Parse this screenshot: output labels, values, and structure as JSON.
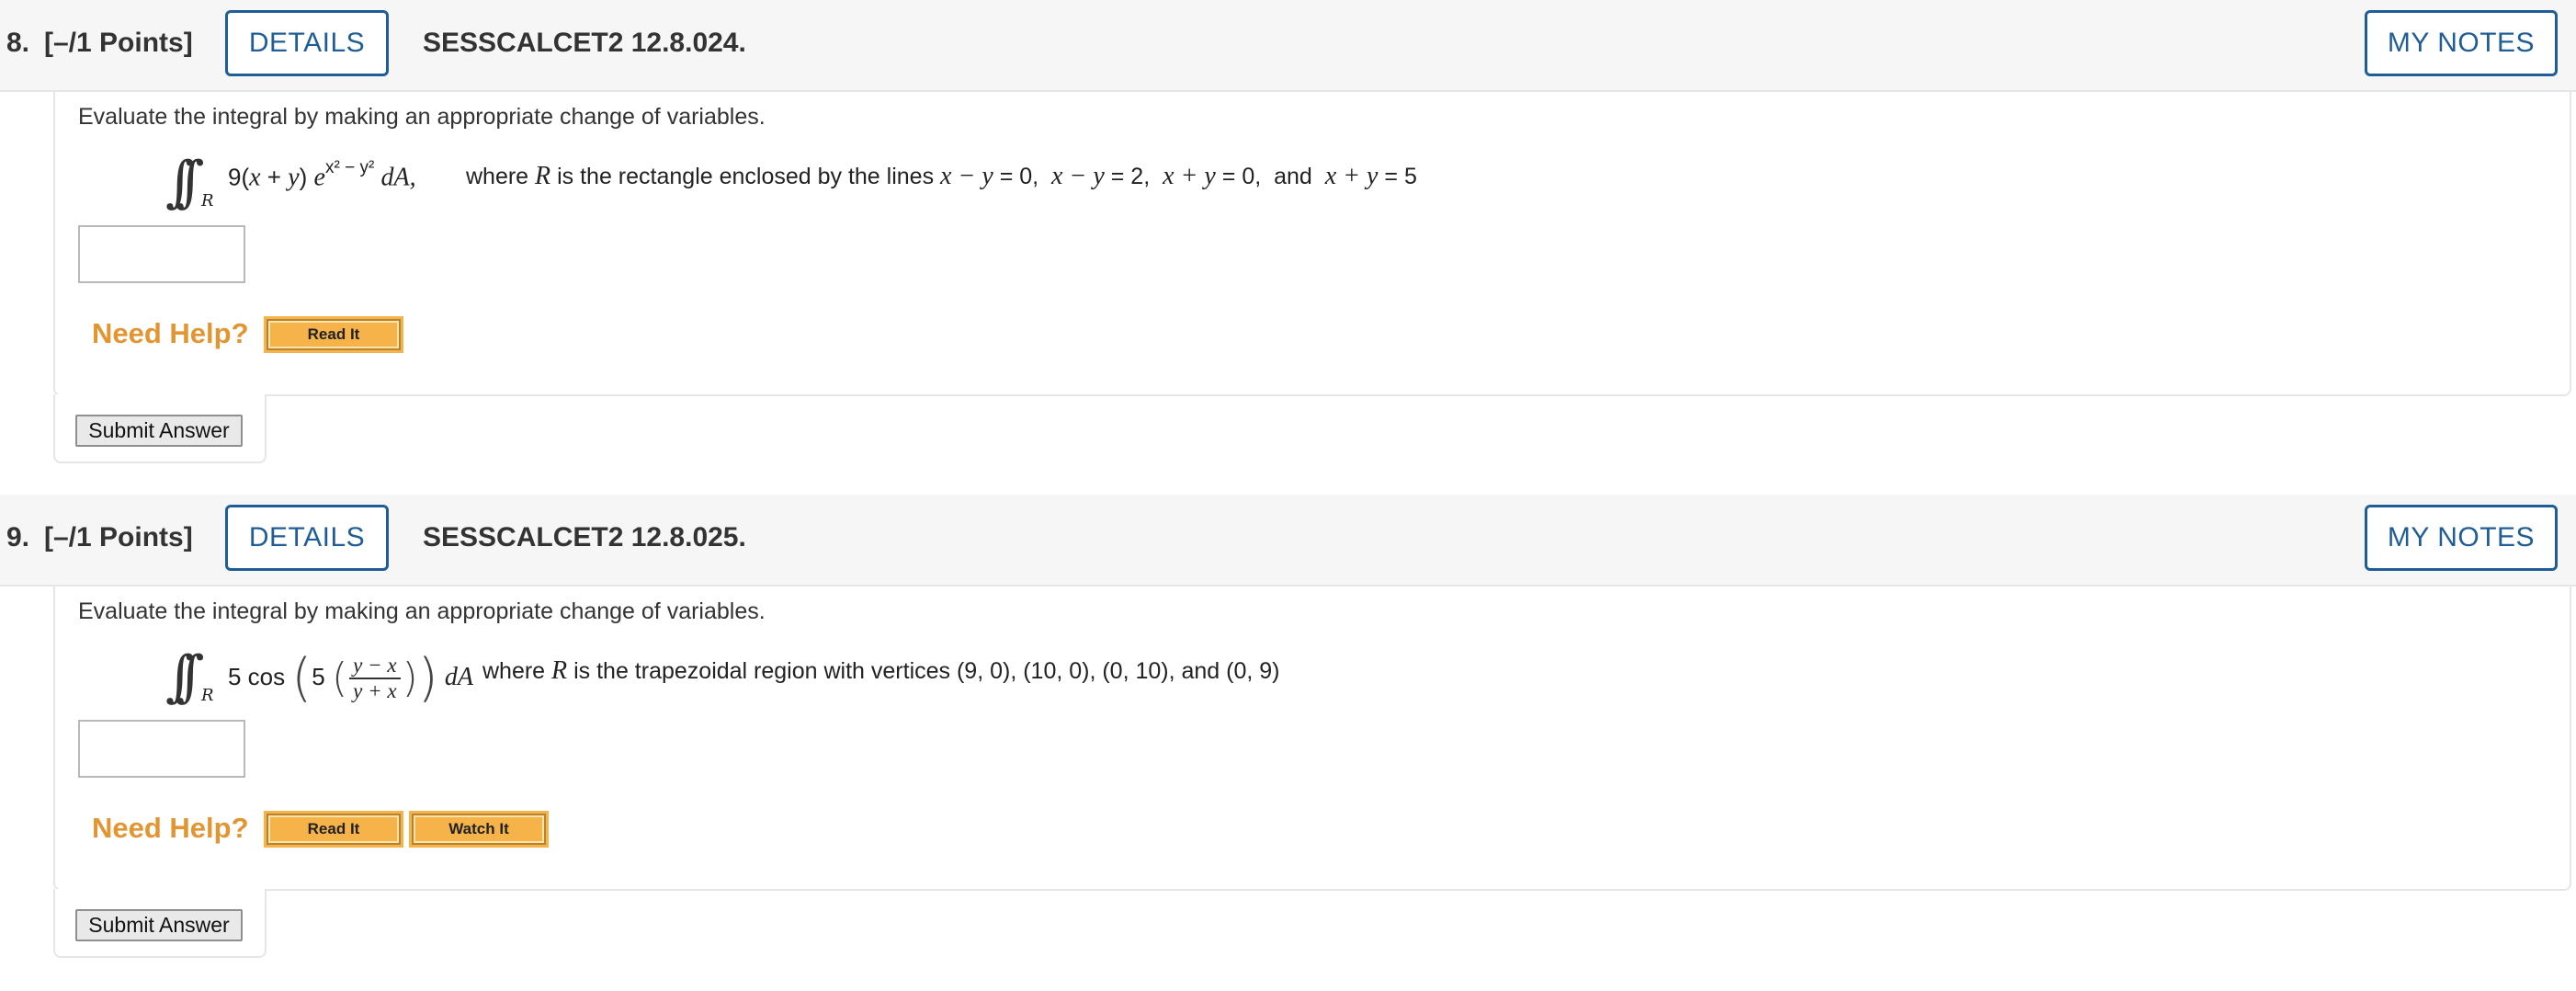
{
  "questions": [
    {
      "number": "8.",
      "points": "[–/1 Points]",
      "details_label": "DETAILS",
      "code": "SESSCALCET2 12.8.024.",
      "mynotes_label": "MY NOTES",
      "prompt": "Evaluate the integral by making an appropriate change of variables.",
      "math": {
        "coef": "9(",
        "x": "x",
        "plus": " + ",
        "y": "y",
        "close": ")",
        "e": "e",
        "exponent": "x² − y²",
        "dA": "dA,",
        "region_text_1": "where ",
        "R": "R",
        "region_text_2": " is the rectangle enclosed by the lines ",
        "lines": [
          {
            "lhs": "x − y",
            "rhs": "0,"
          },
          {
            "lhs": "x − y",
            "rhs": "2,"
          },
          {
            "lhs": "x + y",
            "rhs": "0,"
          },
          {
            "lhs": "x + y",
            "rhs": "5"
          }
        ],
        "and": "and"
      },
      "need_help": "Need Help?",
      "help_buttons": [
        "Read It"
      ],
      "submit_label": "Submit Answer"
    },
    {
      "number": "9.",
      "points": "[–/1 Points]",
      "details_label": "DETAILS",
      "code": "SESSCALCET2 12.8.025.",
      "mynotes_label": "MY NOTES",
      "prompt": "Evaluate the integral by making an appropriate change of variables.",
      "math": {
        "coef": "5 cos",
        "inner_coef": "5",
        "frac_num": "y − x",
        "frac_den": "y + x",
        "dA": "dA",
        "region_text_1": "where ",
        "R": "R",
        "region_text_2": " is the trapezoidal region with vertices (9, 0), (10, 0), (0, 10), and (0, 9)"
      },
      "need_help": "Need Help?",
      "help_buttons": [
        "Read It",
        "Watch It"
      ],
      "submit_label": "Submit Answer"
    }
  ]
}
